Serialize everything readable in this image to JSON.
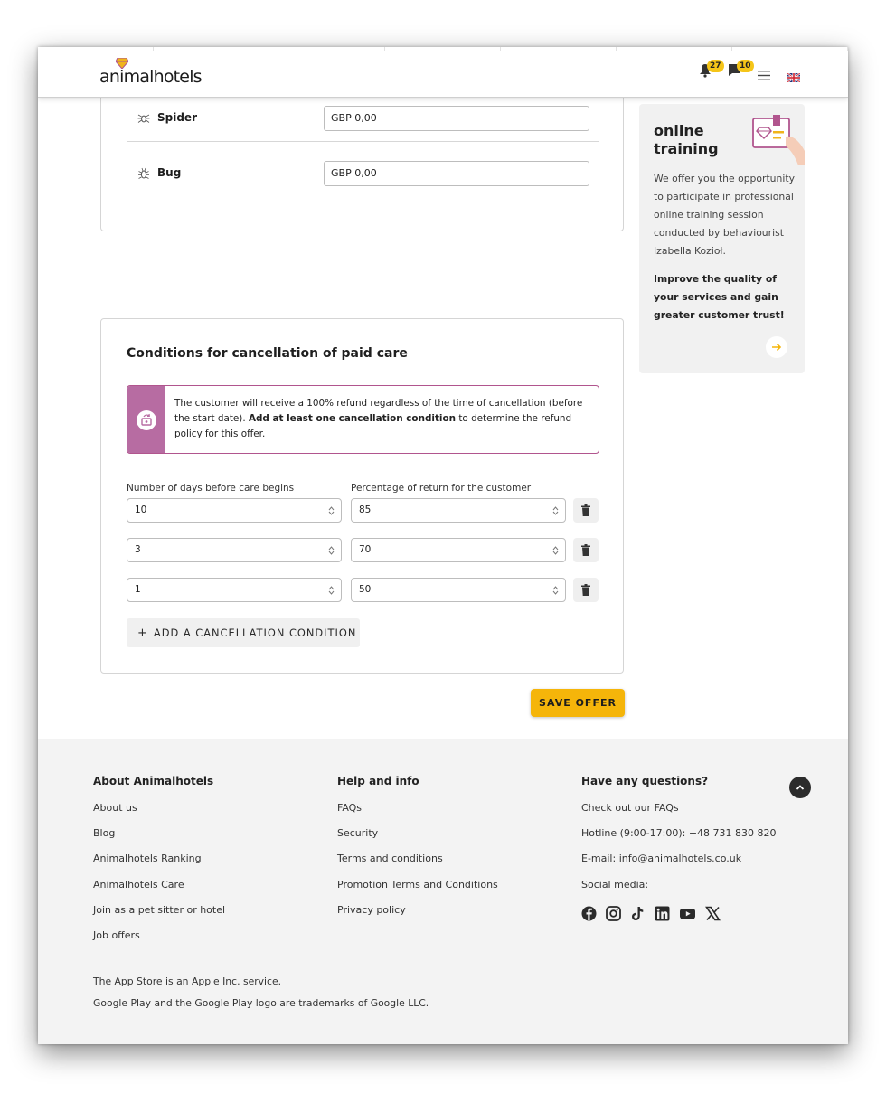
{
  "header": {
    "logo_text": "animalhotels",
    "notifications_count": "27",
    "messages_count": "10"
  },
  "animals": [
    {
      "name": "Spider",
      "price": "GBP 0,00"
    },
    {
      "name": "Bug",
      "price": "GBP 0,00"
    }
  ],
  "cancellation": {
    "title": "Conditions for cancellation of paid care",
    "notice_part1": "The customer will receive a 100% refund regardless of the time of cancellation (before the start date). ",
    "notice_bold": "Add at least one cancellation condition",
    "notice_part2": " to determine the refund policy for this offer.",
    "days_label": "Number of days before care begins",
    "percent_label": "Percentage of return for the customer",
    "rows": [
      {
        "days": "10",
        "percent": "85"
      },
      {
        "days": "3",
        "percent": "70"
      },
      {
        "days": "1",
        "percent": "50"
      }
    ],
    "add_button": "ADD A CANCELLATION CONDITION"
  },
  "save_button": "SAVE OFFER",
  "promo": {
    "title": "online training",
    "text": "We offer you the opportunity to participate in professional online training session conducted by behaviourist Izabella Kozioł.",
    "strong": "Improve the quality of your services and gain greater customer trust!"
  },
  "footer": {
    "col1": {
      "title": "About Animalhotels",
      "links": [
        "About us",
        "Blog",
        "Animalhotels Ranking",
        "Animalhotels Care",
        "Join as a pet sitter or hotel",
        "Job offers"
      ]
    },
    "col2": {
      "title": "Help and info",
      "links": [
        "FAQs",
        "Security",
        "Terms and conditions",
        "Promotion Terms and Conditions",
        "Privacy policy"
      ]
    },
    "col3": {
      "title": "Have any questions?",
      "links": [
        "Check out our FAQs",
        "Hotline (9:00-17:00): +48 731 830 820",
        "E-mail: info@animalhotels.co.uk",
        "Social media:"
      ]
    },
    "social_icons": [
      "facebook-icon",
      "instagram-icon",
      "tiktok-icon",
      "linkedin-icon",
      "youtube-icon",
      "x-icon"
    ],
    "bottom_line1": "The App Store is an Apple Inc. service.",
    "bottom_line2": "Google Play and the Google Play logo are trademarks of Google LLC."
  },
  "colors": {
    "accent_yellow": "#f5b50a",
    "notice_purple": "#b1558e",
    "footer_bg": "#f3f3f3"
  }
}
